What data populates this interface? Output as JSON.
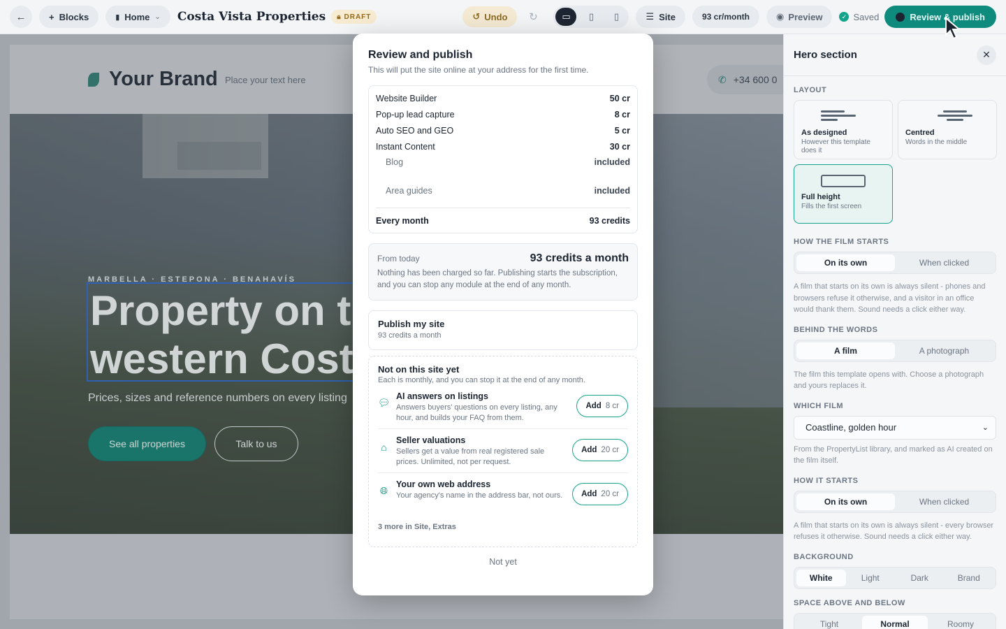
{
  "toolbar": {
    "back_icon": "arrow-left-icon",
    "blocks_label": "Blocks",
    "page_label": "Home",
    "site_title": "Costa Vista Properties",
    "draft_badge": "DRAFT",
    "undo_label": "Undo",
    "site_label": "Site",
    "credits_label": "93 cr/month",
    "preview_label": "Preview",
    "saved_label": "Saved",
    "publish_label": "Review & publish"
  },
  "site": {
    "brand_name": "Your Brand",
    "brand_tagline": "Place your text here",
    "phone": "+34 600 0",
    "eyebrow": "MARBELLA · ESTEPONA · BENAHAVÍS",
    "hero_line1": "Property on th",
    "hero_line2": "western Costa",
    "hero_sub": "Prices, sizes and reference numbers on every listing",
    "cta_primary": "See all properties",
    "cta_secondary": "Talk to us"
  },
  "modal": {
    "title": "Review and publish",
    "subtitle": "This will put the site online at your address for the first time.",
    "lines": [
      {
        "name": "Website Builder",
        "amount": "50 cr"
      },
      {
        "name": "Pop-up lead capture",
        "amount": "8 cr"
      },
      {
        "name": "Auto SEO and GEO",
        "amount": "5 cr"
      },
      {
        "name": "Instant Content",
        "amount": "30 cr"
      },
      {
        "name": "Blog",
        "amount": "included"
      },
      {
        "name": "Area guides",
        "amount": "included"
      }
    ],
    "total_label": "Every month",
    "total_amount": "93 credits",
    "from_today_label": "From today",
    "from_today_amount": "93 credits a month",
    "from_today_note": "Nothing has been charged so far. Publishing starts the subscription, and you can stop any module at the end of any month.",
    "publish_title": "Publish my site",
    "publish_sub": "93 credits a month",
    "extras_title": "Not on this site yet",
    "extras_sub": "Each is monthly, and you can stop it at the end of any month.",
    "modules": [
      {
        "icon": "chat-bubbles-icon",
        "name": "AI answers on listings",
        "desc": "Answers buyers' questions on every listing, any hour, and builds your FAQ from them.",
        "add": "Add",
        "price": "8 cr"
      },
      {
        "icon": "house-tag-icon",
        "name": "Seller valuations",
        "desc": "Sellers get a value from real registered sale prices. Unlimited, not per request.",
        "add": "Add",
        "price": "20 cr"
      },
      {
        "icon": "globe-icon",
        "name": "Your own web address",
        "desc": "Your agency's name in the address bar, not ours.",
        "add": "Add",
        "price": "20 cr"
      }
    ],
    "more_label": "3 more in Site, Extras",
    "not_yet": "Not yet"
  },
  "panel": {
    "title": "Hero section",
    "layout_label": "LAYOUT",
    "layouts": [
      {
        "name": "As designed",
        "desc": "However this template does it"
      },
      {
        "name": "Centred",
        "desc": "Words in the middle"
      },
      {
        "name": "Full height",
        "desc": "Fills the first screen"
      }
    ],
    "film_starts_label": "HOW THE FILM STARTS",
    "film_starts_options": [
      "On its own",
      "When clicked"
    ],
    "film_starts_help": "A film that starts on its own is always silent - phones and browsers refuse it otherwise, and a visitor in an office would thank them. Sound needs a click either way.",
    "behind_label": "BEHIND THE WORDS",
    "behind_options": [
      "A film",
      "A photograph"
    ],
    "behind_help": "The film this template opens with. Choose a photograph and yours replaces it.",
    "which_film_label": "WHICH FILM",
    "which_film_value": "Coastline, golden hour",
    "which_film_help": "From the PropertyList library, and marked as AI created on the film itself.",
    "how_starts_label": "HOW IT STARTS",
    "how_starts_options": [
      "On its own",
      "When clicked"
    ],
    "how_starts_help": "A film that starts on its own is always silent - every browser refuses it otherwise. Sound needs a click either way.",
    "background_label": "BACKGROUND",
    "background_options": [
      "White",
      "Light",
      "Dark",
      "Brand"
    ],
    "space_label": "SPACE ABOVE AND BELOW",
    "space_options": [
      "Tight",
      "Normal",
      "Roomy"
    ]
  },
  "colors": {
    "accent": "#0f8b7d",
    "selection": "#2b64c9"
  }
}
